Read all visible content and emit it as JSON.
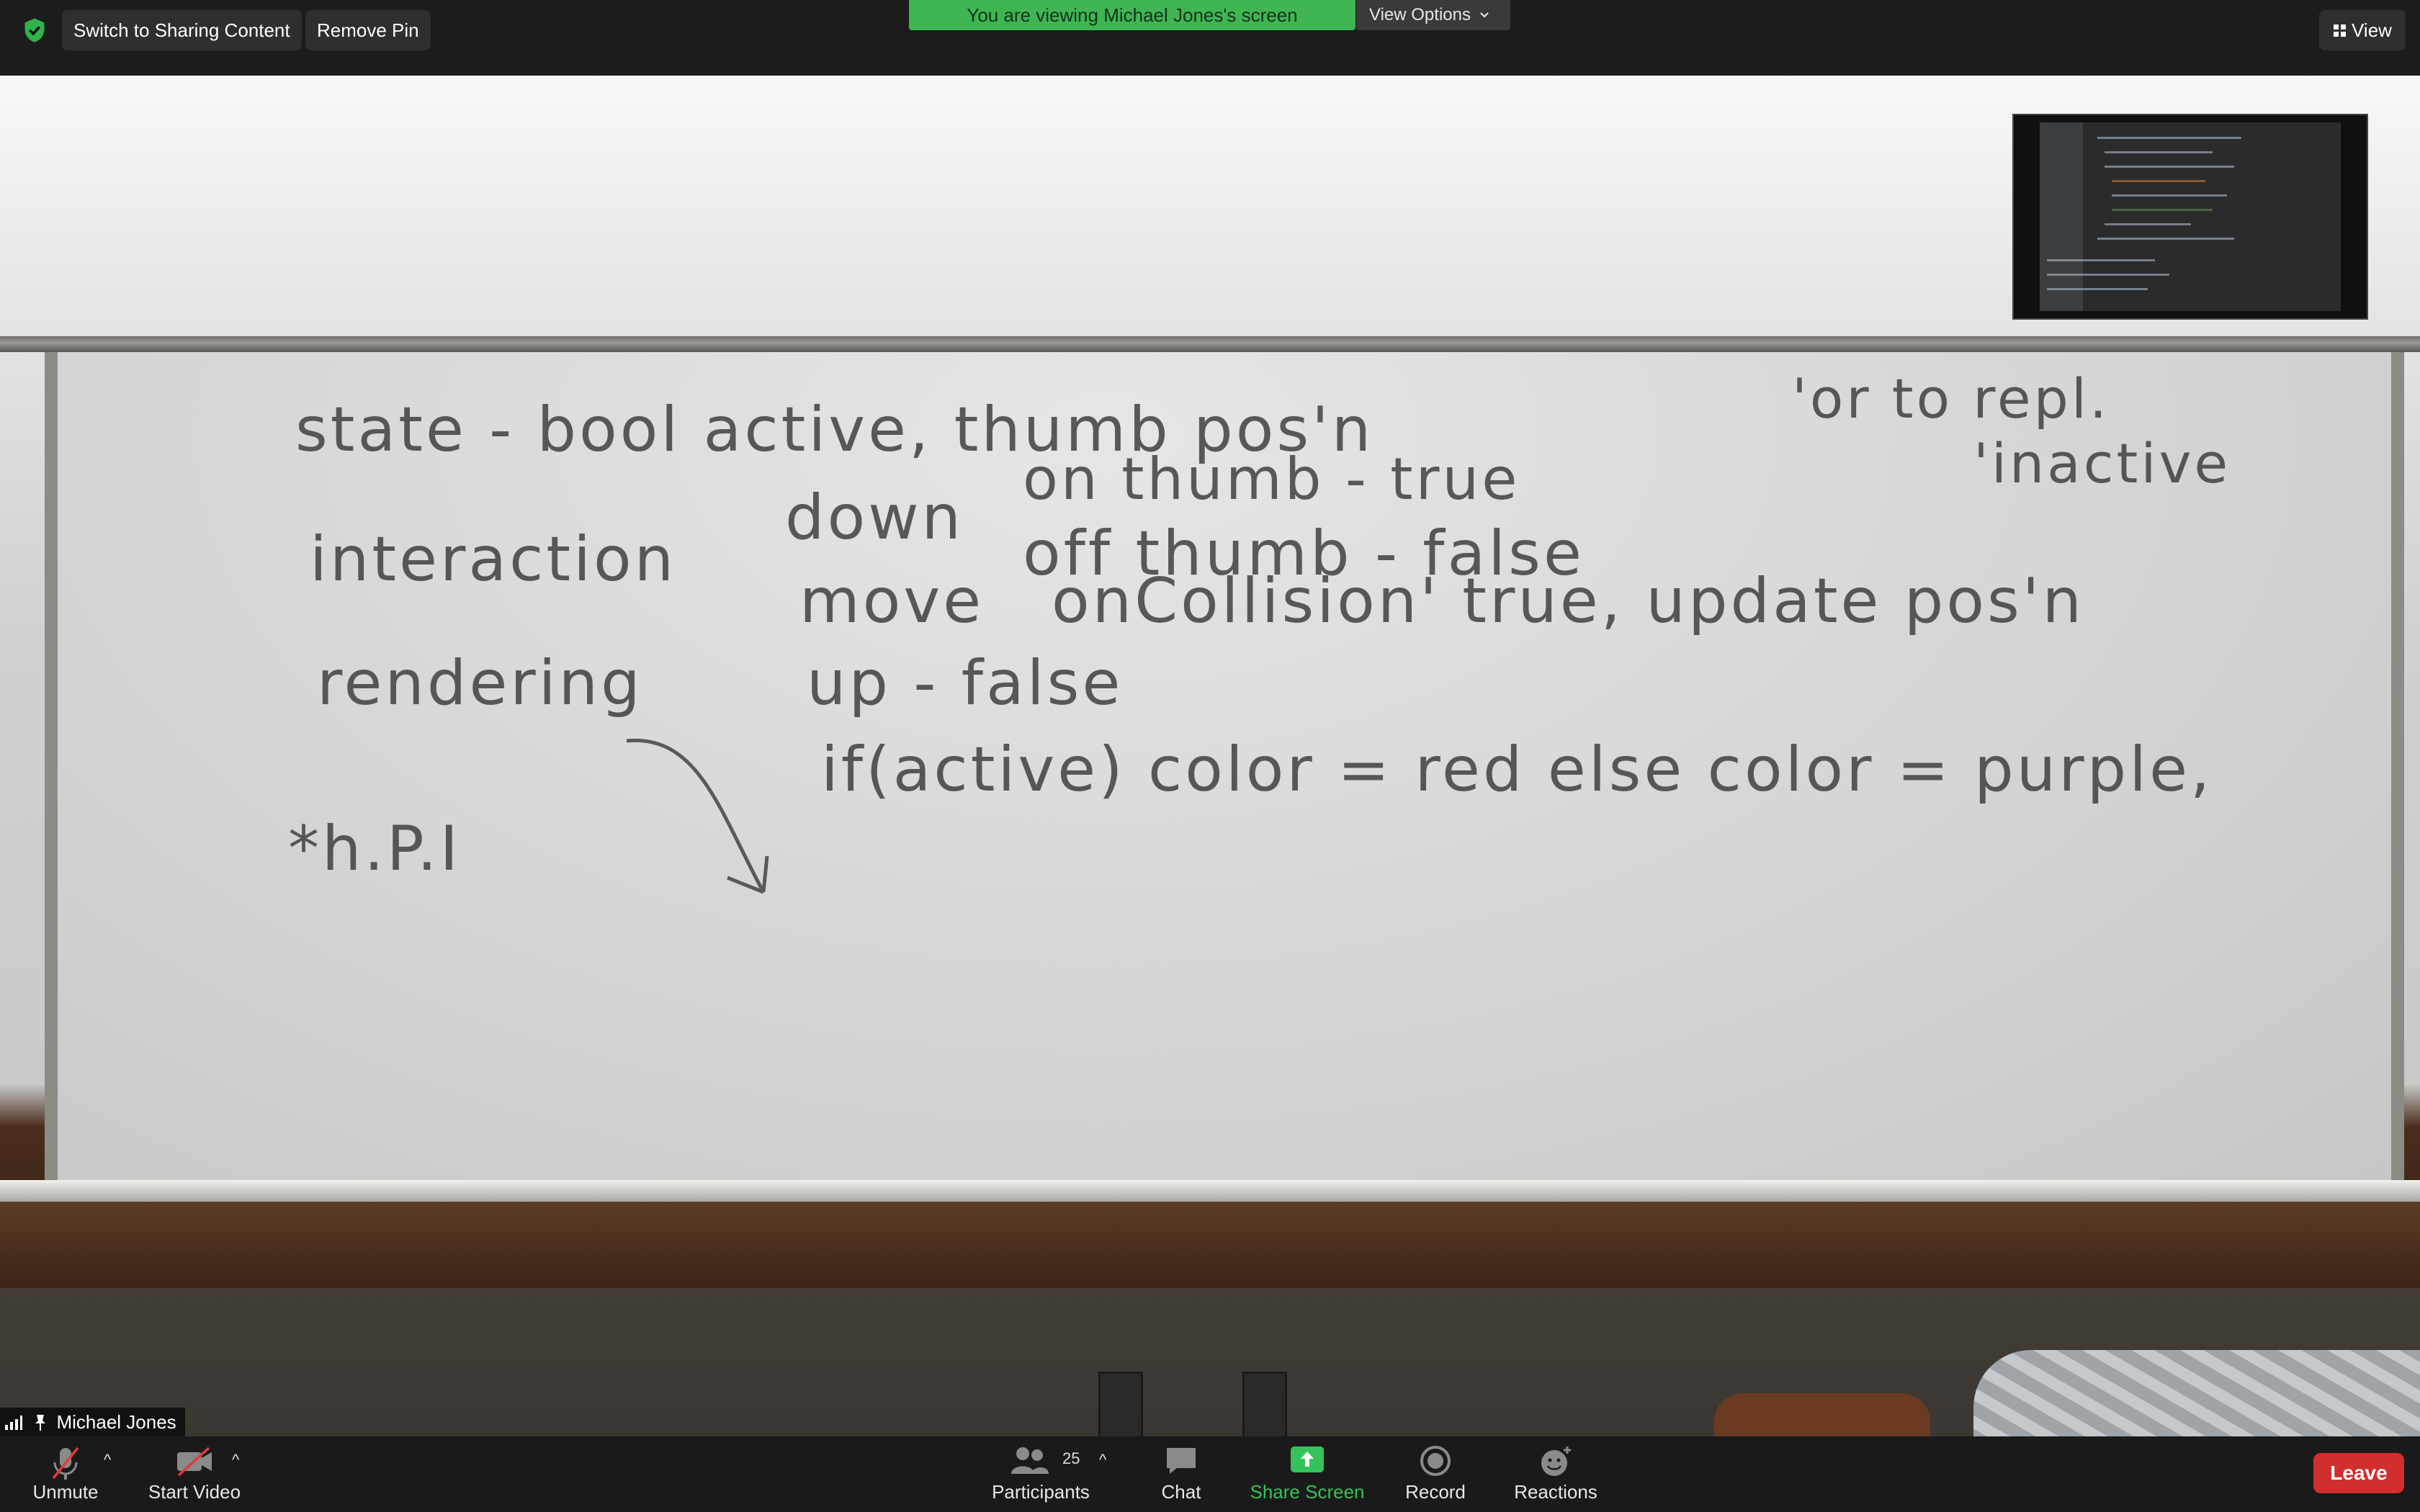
{
  "top_bar": {
    "switch_button": "Switch to Sharing Content",
    "remove_pin_button": "Remove Pin",
    "banner": "You are viewing Michael Jones's screen",
    "view_options": "View Options",
    "view_button": "View"
  },
  "whiteboard": {
    "lines": [
      "state - bool active, thumb pos'n",
      "'or to repl.",
      "on thumb - true",
      "'inactive",
      "interaction",
      "down",
      "off thumb - false",
      "move",
      "onCollision' true, update pos'n",
      "rendering",
      "up - false",
      "if(active) color = red else color = purple,",
      "*h.P.I"
    ]
  },
  "name_tag": "Michael Jones",
  "toolbar": {
    "unmute": "Unmute",
    "start_video": "Start Video",
    "participants": "Participants",
    "participants_count": "25",
    "chat": "Chat",
    "share_screen": "Share Screen",
    "record": "Record",
    "reactions": "Reactions",
    "leave": "Leave"
  },
  "colors": {
    "banner_green": "#3fb553",
    "share_green": "#36c25a",
    "leave_red": "#d12e2e"
  },
  "icons": [
    "shield-check-icon",
    "chevron-down-icon",
    "grid-icon",
    "signal-icon",
    "pin-icon",
    "mic-muted-icon",
    "video-off-icon",
    "participants-icon",
    "chat-icon",
    "share-screen-icon",
    "record-icon",
    "reactions-icon"
  ]
}
